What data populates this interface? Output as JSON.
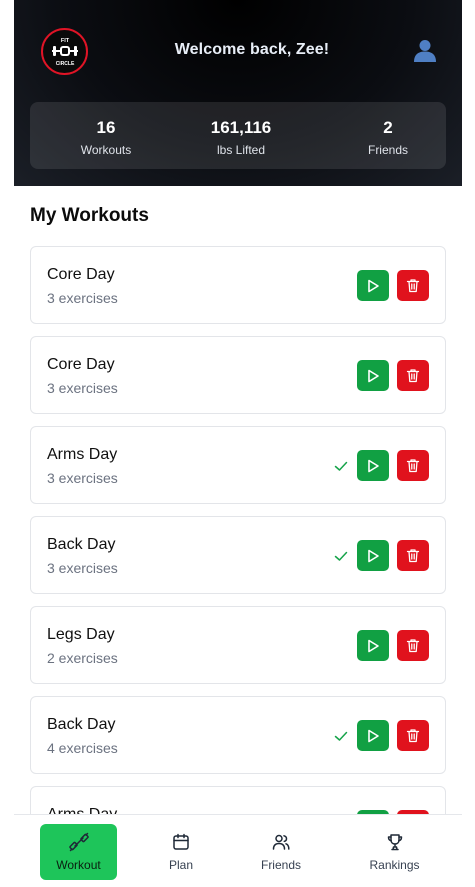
{
  "header": {
    "logo_text_top": "FIT",
    "logo_text_bottom": "CIRCLE",
    "welcome": "Welcome back, Zee!",
    "profile_icon": "user-silhouette-icon"
  },
  "stats": [
    {
      "value": "16",
      "label": "Workouts"
    },
    {
      "value": "161,116",
      "label": "lbs Lifted"
    },
    {
      "value": "2",
      "label": "Friends"
    }
  ],
  "section_title": "My Workouts",
  "workouts": [
    {
      "name": "Core Day",
      "exercises": "3 exercises",
      "completed": false
    },
    {
      "name": "Core Day",
      "exercises": "3 exercises",
      "completed": false
    },
    {
      "name": "Arms Day",
      "exercises": "3 exercises",
      "completed": true
    },
    {
      "name": "Back Day",
      "exercises": "3 exercises",
      "completed": true
    },
    {
      "name": "Legs Day",
      "exercises": "2 exercises",
      "completed": false
    },
    {
      "name": "Back Day",
      "exercises": "4 exercises",
      "completed": true
    },
    {
      "name": "Arms Day",
      "exercises": "",
      "completed": false
    }
  ],
  "nav": [
    {
      "label": "Workout",
      "icon": "dumbbell-icon",
      "active": true
    },
    {
      "label": "Plan",
      "icon": "calendar-icon",
      "active": false
    },
    {
      "label": "Friends",
      "icon": "users-icon",
      "active": false
    },
    {
      "label": "Rankings",
      "icon": "trophy-icon",
      "active": false
    }
  ],
  "colors": {
    "play": "#11a043",
    "delete": "#e0121d",
    "active_nav": "#1ec55a",
    "check": "#16a34a"
  }
}
